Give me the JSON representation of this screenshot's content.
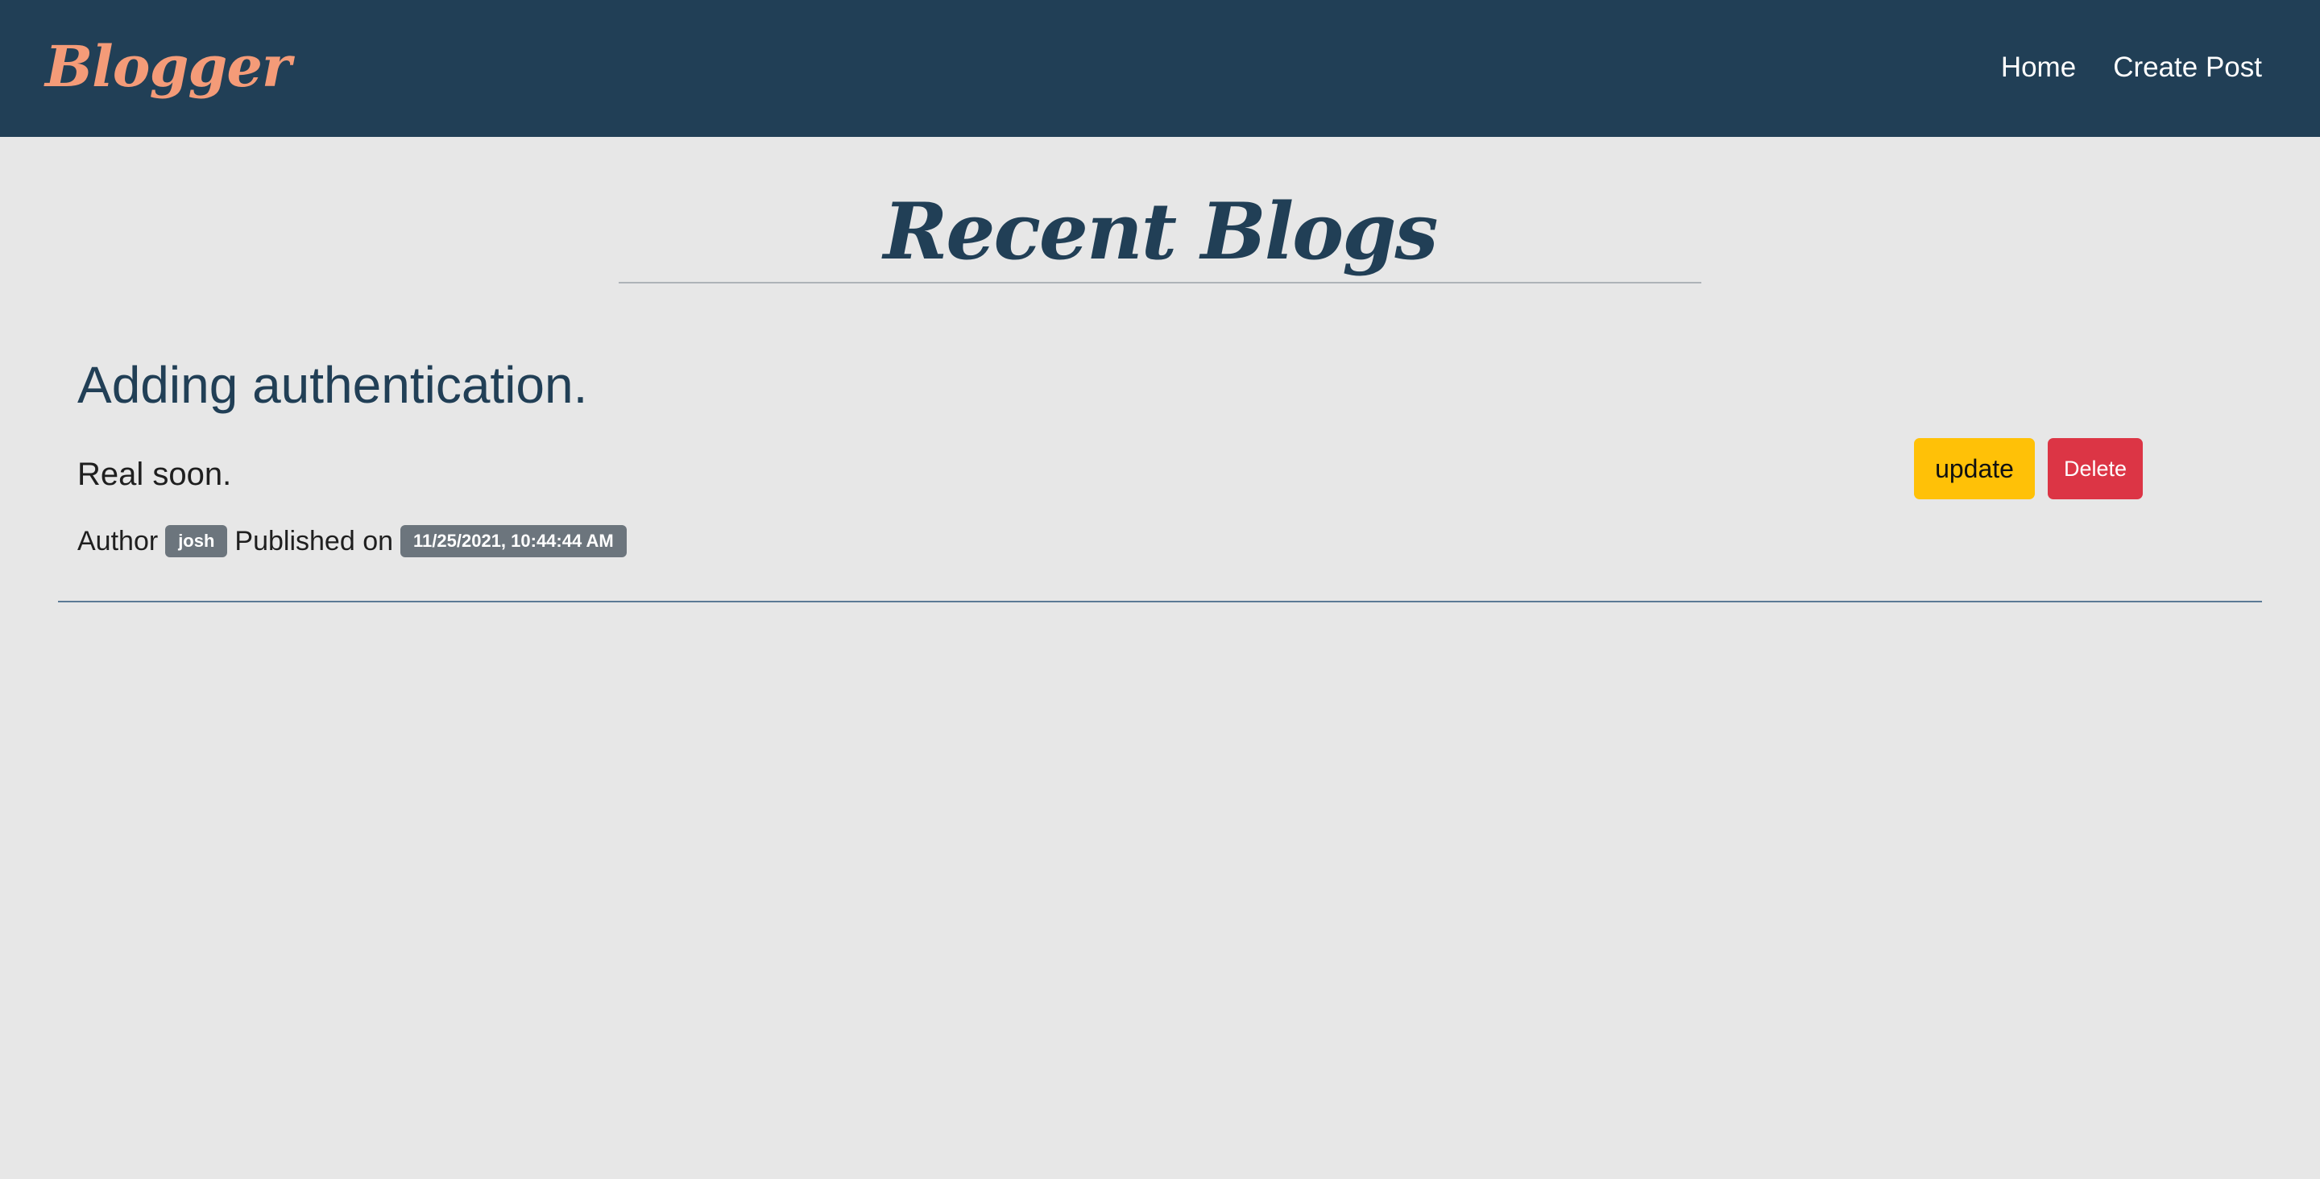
{
  "navbar": {
    "brand": "Blogger",
    "links": [
      {
        "label": "Home"
      },
      {
        "label": "Create Post"
      }
    ],
    "colors": {
      "background": "#213f56",
      "brand": "#f49b78",
      "link": "#ffffff"
    }
  },
  "main": {
    "title": "Recent Blogs",
    "posts": [
      {
        "title": "Adding authentication.",
        "body": "Real soon.",
        "author_label": "Author",
        "author": "josh",
        "published_label": "Published on",
        "published": "11/25/2021, 10:44:44 AM",
        "update_label": "update",
        "delete_label": "Delete"
      }
    ]
  },
  "colors": {
    "page_background": "#e7e7e7",
    "title": "#213f56",
    "badge": "#6c757d",
    "update_button": "#ffc107",
    "delete_button": "#dc3545"
  }
}
